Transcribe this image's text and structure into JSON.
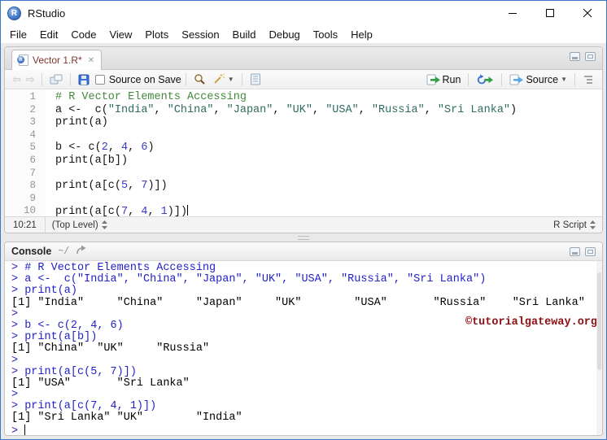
{
  "window": {
    "title": "RStudio"
  },
  "menu": {
    "items": [
      "File",
      "Edit",
      "Code",
      "View",
      "Plots",
      "Session",
      "Build",
      "Debug",
      "Tools",
      "Help"
    ]
  },
  "icons": {
    "back": "⇦",
    "forward": "⇨",
    "tab_close": "✕",
    "dropdown": "▼"
  },
  "source_pane": {
    "tab": {
      "label": "Vector 1.R*"
    },
    "toolbar": {
      "source_on_save_label": "Source on Save",
      "run_label": "Run",
      "source_label": "Source"
    },
    "editor": {
      "lines": [
        {
          "num": 1,
          "segments": [
            {
              "text": "# R Vector Elements Accessing",
              "type": "comment"
            }
          ]
        },
        {
          "num": 2,
          "segments": [
            {
              "text": "a <-  c(",
              "type": "code"
            },
            {
              "text": "\"India\"",
              "type": "string"
            },
            {
              "text": ", ",
              "type": "code"
            },
            {
              "text": "\"China\"",
              "type": "string"
            },
            {
              "text": ", ",
              "type": "code"
            },
            {
              "text": "\"Japan\"",
              "type": "string"
            },
            {
              "text": ", ",
              "type": "code"
            },
            {
              "text": "\"UK\"",
              "type": "string"
            },
            {
              "text": ", ",
              "type": "code"
            },
            {
              "text": "\"USA\"",
              "type": "string"
            },
            {
              "text": ", ",
              "type": "code"
            },
            {
              "text": "\"Russia\"",
              "type": "string"
            },
            {
              "text": ", ",
              "type": "code"
            },
            {
              "text": "\"Sri Lanka\"",
              "type": "string"
            },
            {
              "text": ")",
              "type": "code"
            }
          ]
        },
        {
          "num": 3,
          "segments": [
            {
              "text": "print(a)",
              "type": "code"
            }
          ]
        },
        {
          "num": 4,
          "segments": []
        },
        {
          "num": 5,
          "segments": [
            {
              "text": "b <- c(",
              "type": "code"
            },
            {
              "text": "2",
              "type": "number"
            },
            {
              "text": ", ",
              "type": "code"
            },
            {
              "text": "4",
              "type": "number"
            },
            {
              "text": ", ",
              "type": "code"
            },
            {
              "text": "6",
              "type": "number"
            },
            {
              "text": ")",
              "type": "code"
            }
          ]
        },
        {
          "num": 6,
          "segments": [
            {
              "text": "print(a[b])",
              "type": "code"
            }
          ]
        },
        {
          "num": 7,
          "segments": []
        },
        {
          "num": 8,
          "segments": [
            {
              "text": "print(a[c(",
              "type": "code"
            },
            {
              "text": "5",
              "type": "number"
            },
            {
              "text": ", ",
              "type": "code"
            },
            {
              "text": "7",
              "type": "number"
            },
            {
              "text": ")])",
              "type": "code"
            }
          ]
        },
        {
          "num": 9,
          "segments": []
        },
        {
          "num": 10,
          "cursor": true,
          "segments": [
            {
              "text": "print(a[c(",
              "type": "code"
            },
            {
              "text": "7",
              "type": "number"
            },
            {
              "text": ", ",
              "type": "code"
            },
            {
              "text": "4",
              "type": "number"
            },
            {
              "text": ", ",
              "type": "code"
            },
            {
              "text": "1",
              "type": "number"
            },
            {
              "text": ")])",
              "type": "code"
            }
          ]
        }
      ]
    },
    "statusbar": {
      "cursor_position": "10:21",
      "scope": "(Top Level)",
      "file_type": "R Script"
    }
  },
  "console_pane": {
    "title": "Console",
    "path": "~/",
    "watermark": "©tutorialgateway.org",
    "lines": [
      {
        "type": "input",
        "text": "> # R Vector Elements Accessing"
      },
      {
        "type": "input",
        "text": "> a <-  c(\"India\", \"China\", \"Japan\", \"UK\", \"USA\", \"Russia\", \"Sri Lanka\")"
      },
      {
        "type": "input",
        "text": "> print(a)"
      },
      {
        "type": "output",
        "text": "[1] \"India\"     \"China\"     \"Japan\"     \"UK\"        \"USA\"       \"Russia\"    \"Sri Lanka\""
      },
      {
        "type": "input",
        "text": "> "
      },
      {
        "type": "input",
        "text": "> b <- c(2, 4, 6)"
      },
      {
        "type": "input",
        "text": "> print(a[b])"
      },
      {
        "type": "output",
        "text": "[1] \"China\"  \"UK\"     \"Russia\""
      },
      {
        "type": "input",
        "text": "> "
      },
      {
        "type": "input",
        "text": "> print(a[c(5, 7)])"
      },
      {
        "type": "output",
        "text": "[1] \"USA\"       \"Sri Lanka\""
      },
      {
        "type": "input",
        "text": "> "
      },
      {
        "type": "input",
        "text": "> print(a[c(7, 4, 1)])"
      },
      {
        "type": "output",
        "text": "[1] \"Sri Lanka\" \"UK\"        \"India\""
      },
      {
        "type": "input",
        "text": "> ",
        "cursor": true
      }
    ]
  },
  "colors": {
    "window_border": "#3a76c9",
    "accent_green": "#2f9e44",
    "accent_blue": "#3a6fd8",
    "comment": "#43883c",
    "string": "#2e6b5e",
    "number": "#3a3ac8",
    "console_input": "#2222c8",
    "console_output": "#000000",
    "watermark": "#8b0f12",
    "tab_modified": "#7d352b"
  }
}
